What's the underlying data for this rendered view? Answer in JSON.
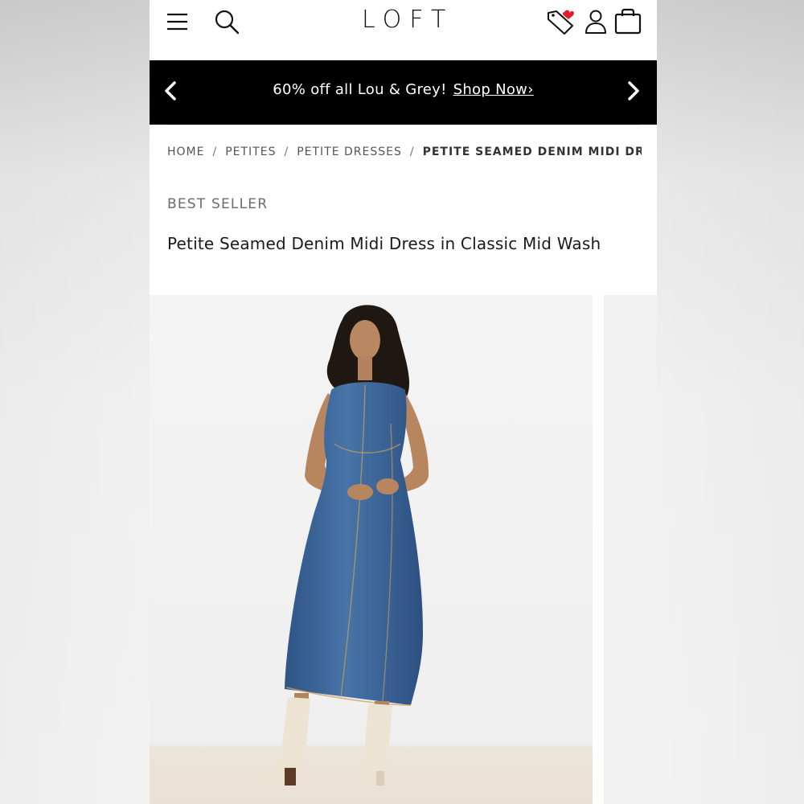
{
  "header": {
    "logo": "LOFT",
    "icons": [
      "menu-icon",
      "search-icon",
      "wishlist-icon",
      "user-icon",
      "bag-icon"
    ]
  },
  "promo": {
    "text": "60% off all Lou & Grey!",
    "link_label": "Shop Now›"
  },
  "breadcrumb": {
    "items": [
      "HOME",
      "PETITES",
      "PETITE DRESSES",
      "PETITE SEAMED DENIM MIDI DRESS I..."
    ],
    "separator": "/"
  },
  "product": {
    "badge": "BEST SELLER",
    "title": "Petite Seamed Denim Midi Dress in Classic Mid Wash"
  },
  "colors": {
    "promo_bg": "#000000",
    "denim": "#3f6a9c",
    "boots": "#ece3d3",
    "photo_bg": "#f2f2f2",
    "wishlist_badge": "#e21b2d"
  }
}
